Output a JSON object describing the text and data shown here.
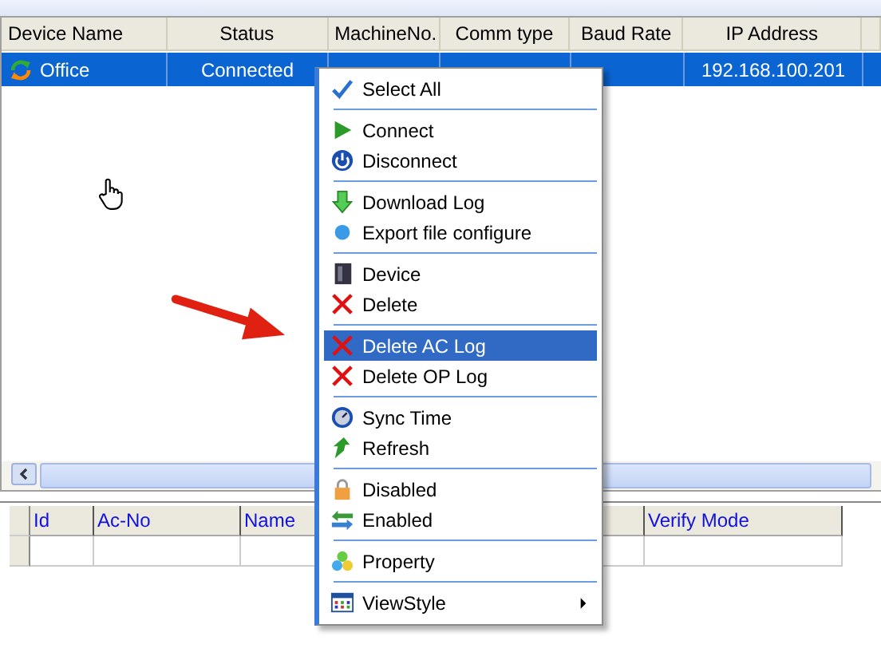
{
  "device_table": {
    "columns": [
      "Device Name",
      "Status",
      "MachineNo.",
      "Comm type",
      "Baud Rate",
      "IP Address"
    ],
    "rows": [
      {
        "cells": [
          "Office",
          "Connected",
          "",
          "",
          "",
          "192.168.100.201"
        ],
        "selected": true
      }
    ]
  },
  "log_table": {
    "columns": [
      "Id",
      "Ac-No",
      "Name",
      "",
      "Verify Mode"
    ]
  },
  "context_menu": {
    "groups": [
      [
        {
          "label": "Select All",
          "selected": false,
          "submenu": false
        }
      ],
      [
        {
          "label": "Connect",
          "selected": false,
          "submenu": false
        },
        {
          "label": "Disconnect",
          "selected": false,
          "submenu": false
        }
      ],
      [
        {
          "label": "Download Log",
          "selected": false,
          "submenu": false
        },
        {
          "label": "Export file configure",
          "selected": false,
          "submenu": false
        }
      ],
      [
        {
          "label": "Device",
          "selected": false,
          "submenu": false
        },
        {
          "label": "Delete",
          "selected": false,
          "submenu": false
        }
      ],
      [
        {
          "label": "Delete AC Log",
          "selected": true,
          "submenu": false
        },
        {
          "label": "Delete OP Log",
          "selected": false,
          "submenu": false
        }
      ],
      [
        {
          "label": "Sync Time",
          "selected": false,
          "submenu": false
        },
        {
          "label": "Refresh",
          "selected": false,
          "submenu": false
        }
      ],
      [
        {
          "label": "Disabled",
          "selected": false,
          "submenu": false
        },
        {
          "label": "Enabled",
          "selected": false,
          "submenu": false
        }
      ],
      [
        {
          "label": "Property",
          "selected": false,
          "submenu": false
        }
      ],
      [
        {
          "label": "ViewStyle",
          "selected": false,
          "submenu": true
        }
      ]
    ]
  }
}
